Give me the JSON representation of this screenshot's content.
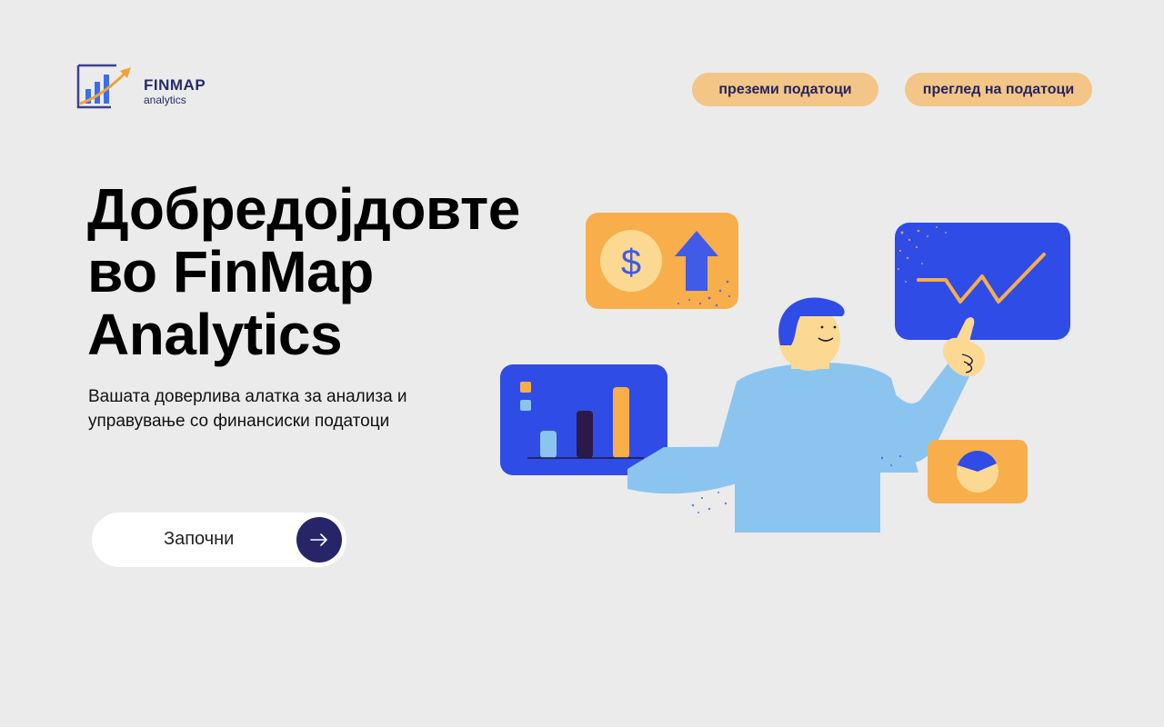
{
  "brand": {
    "name": "FINMAP",
    "tagline": "analytics"
  },
  "nav": {
    "download_label": "преземи податоци",
    "overview_label": "преглед на податоци"
  },
  "hero": {
    "title": "Добредојдовте во FinMap Analytics",
    "subtitle": "Вашата доверлива алатка за анализа и управување со финансиски податоци",
    "cta_label": "Започни",
    "cta_icon": "arrow-right-icon"
  },
  "illustration": {
    "dollar_symbol": "$"
  },
  "colors": {
    "background": "#ebebeb",
    "accent_orange": "#f8ae4b",
    "accent_blue": "#2f4ce6",
    "navy": "#262567",
    "nav_button": "#f3c587",
    "shirt_blue": "#8cc4f0",
    "skin": "#fbd98a"
  }
}
